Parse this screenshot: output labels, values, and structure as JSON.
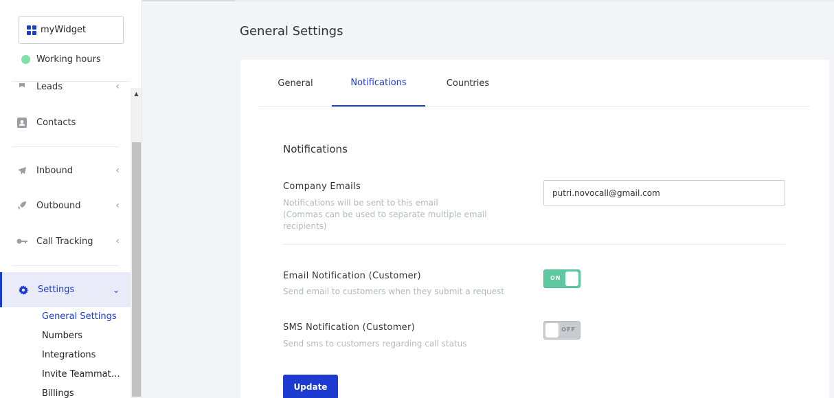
{
  "sidebar": {
    "widget_label": "myWidget",
    "working_hours": "Working hours",
    "status_color": "#7ee2a6",
    "items": [
      {
        "label": "Leads",
        "icon": "pin-icon"
      },
      {
        "label": "Contacts",
        "icon": "contact-card-icon"
      },
      {
        "label": "Inbound",
        "icon": "airplane-icon"
      },
      {
        "label": "Outbound",
        "icon": "rocket-icon"
      },
      {
        "label": "Call Tracking",
        "icon": "key-icon"
      },
      {
        "label": "Settings",
        "icon": "gear-icon"
      }
    ],
    "settings_sub": [
      {
        "label": "General Settings"
      },
      {
        "label": "Numbers"
      },
      {
        "label": "Integrations"
      },
      {
        "label": "Invite Teammat…"
      },
      {
        "label": "Billings"
      }
    ]
  },
  "page": {
    "title": "General Settings",
    "tabs": [
      {
        "label": "General"
      },
      {
        "label": "Notifications"
      },
      {
        "label": "Countries"
      }
    ],
    "active_tab": "Notifications"
  },
  "notifications": {
    "section_title": "Notifications",
    "company_emails": {
      "label": "Company Emails",
      "help_line1": "Notifications will be sent to this email",
      "help_line2": "(Commas can be used to separate multiple email recipients)",
      "value": "putri.novocall@gmail.com"
    },
    "email_notification": {
      "label": "Email Notification (Customer)",
      "help": "Send email to customers when they submit a request",
      "toggle_text": "ON"
    },
    "sms_notification": {
      "label": "SMS Notification (Customer)",
      "help": "Send sms to customers regarding call status",
      "toggle_text": "OFF"
    },
    "update_label": "Update"
  },
  "colors": {
    "accent": "#1d3bd1",
    "toggle_on": "#5cc9a0",
    "toggle_off": "#c8cbd1"
  }
}
